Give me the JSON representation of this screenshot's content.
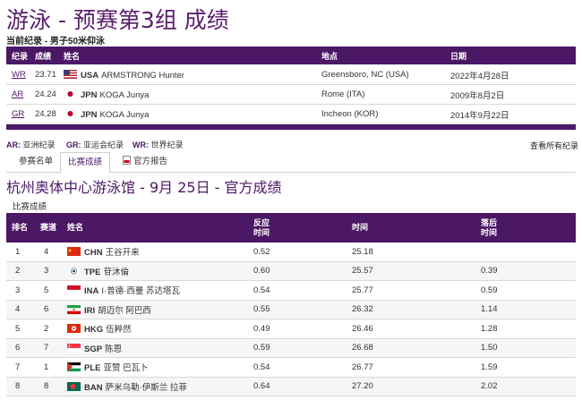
{
  "page": {
    "title": "游泳 - 预赛第3组 成绩",
    "subtitle": "当前纪录 - 男子50米仰泳"
  },
  "records": {
    "headers": [
      "纪录",
      "成绩",
      "姓名",
      "地点",
      "日期"
    ],
    "rows": [
      {
        "code": "WR",
        "mark": "23.71",
        "noc": "USA",
        "name": "ARMSTRONG Hunter",
        "place": "Greensboro, NC (USA)",
        "date": "2022年4月28日",
        "flag": "usa"
      },
      {
        "code": "AR",
        "mark": "24.24",
        "noc": "JPN",
        "name": "KOGA Junya",
        "place": "Rome (ITA)",
        "date": "2009年8月2日",
        "flag": "jpn"
      },
      {
        "code": "GR",
        "mark": "24.28",
        "noc": "JPN",
        "name": "KOGA Junya",
        "place": "Incheon (KOR)",
        "date": "2014年9月22日",
        "flag": "jpn"
      }
    ]
  },
  "legend": {
    "ar_code": "AR:",
    "ar_text": "亚洲纪录",
    "gr_code": "GR:",
    "gr_text": "亚运会纪录",
    "wr_code": "WR:",
    "wr_text": "世界纪录",
    "view_all": "查看所有纪录"
  },
  "tabs": [
    {
      "label": "参赛名单",
      "active": false
    },
    {
      "label": "比赛成绩",
      "active": true
    },
    {
      "label": "官方报告",
      "active": false
    }
  ],
  "venue": "杭州奥体中心游泳馆 - 9月 25日 - 官方成绩",
  "results_label": "比赛成绩",
  "results": {
    "headers": {
      "rank": "排名",
      "lane": "赛道",
      "name": "姓名",
      "reaction_1": "反应",
      "reaction_2": "时间",
      "time": "时间",
      "behind_1": "落后",
      "behind_2": "时间"
    },
    "rows": [
      {
        "rank": "1",
        "lane": "4",
        "noc": "CHN",
        "name": "王谷开来",
        "reaction": "0.52",
        "time": "25.18",
        "behind": "",
        "flag": "chn"
      },
      {
        "rank": "2",
        "lane": "3",
        "noc": "TPE",
        "name": "苷沐倫",
        "reaction": "0.60",
        "time": "25.57",
        "behind": "0.39",
        "flag": "tpe"
      },
      {
        "rank": "3",
        "lane": "5",
        "noc": "INA",
        "name": "I·普德·西曼 苏达塔瓦",
        "reaction": "0.54",
        "time": "25.77",
        "behind": "0.59",
        "flag": "ina"
      },
      {
        "rank": "4",
        "lane": "6",
        "noc": "IRI",
        "name": "胡迈尔 阿巴西",
        "reaction": "0.55",
        "time": "26.32",
        "behind": "1.14",
        "flag": "iri"
      },
      {
        "rank": "5",
        "lane": "2",
        "noc": "HKG",
        "name": "伍粹然",
        "reaction": "0.49",
        "time": "26.46",
        "behind": "1.28",
        "flag": "hkg"
      },
      {
        "rank": "6",
        "lane": "7",
        "noc": "SGP",
        "name": "陈恩",
        "reaction": "0.59",
        "time": "26.68",
        "behind": "1.50",
        "flag": "sgp"
      },
      {
        "rank": "7",
        "lane": "1",
        "noc": "PLE",
        "name": "亚赞 巴瓦卜",
        "reaction": "0.54",
        "time": "26.77",
        "behind": "1.59",
        "flag": "ple"
      },
      {
        "rank": "8",
        "lane": "8",
        "noc": "BAN",
        "name": "萨米乌勒·伊斯兰 拉菲",
        "reaction": "0.64",
        "time": "27.20",
        "behind": "2.02",
        "flag": "ban"
      }
    ]
  },
  "colors": {
    "brand": "#4c1765",
    "title": "#5b1e6e"
  }
}
